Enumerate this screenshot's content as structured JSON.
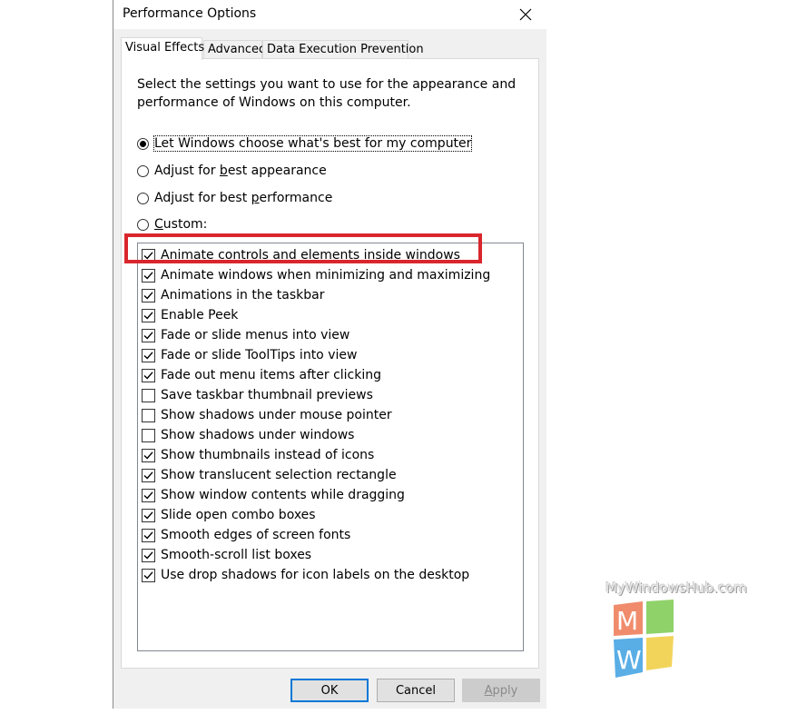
{
  "window": {
    "title": "Performance Options"
  },
  "tabs": [
    {
      "label": "Visual Effects",
      "active": true
    },
    {
      "label": "Advanced",
      "active": false
    },
    {
      "label": "Data Execution Prevention",
      "active": false
    }
  ],
  "description": "Select the settings you want to use for the appearance and performance of Windows on this computer.",
  "radios": [
    {
      "pre": "Let Windows choose what's best for my computer",
      "ul": "",
      "post": "",
      "checked": true
    },
    {
      "pre": "Adjust for ",
      "ul": "b",
      "post": "est appearance",
      "checked": false
    },
    {
      "pre": "Adjust for best ",
      "ul": "p",
      "post": "erformance",
      "checked": false
    },
    {
      "pre": "",
      "ul": "C",
      "post": "ustom:",
      "checked": false
    }
  ],
  "checkboxes": [
    {
      "label": "Animate controls and elements inside windows",
      "checked": true
    },
    {
      "label": "Animate windows when minimizing and maximizing",
      "checked": true
    },
    {
      "label": "Animations in the taskbar",
      "checked": true
    },
    {
      "label": "Enable Peek",
      "checked": true
    },
    {
      "label": "Fade or slide menus into view",
      "checked": true
    },
    {
      "label": "Fade or slide ToolTips into view",
      "checked": true
    },
    {
      "label": "Fade out menu items after clicking",
      "checked": true
    },
    {
      "label": "Save taskbar thumbnail previews",
      "checked": false
    },
    {
      "label": "Show shadows under mouse pointer",
      "checked": false
    },
    {
      "label": "Show shadows under windows",
      "checked": false
    },
    {
      "label": "Show thumbnails instead of icons",
      "checked": true
    },
    {
      "label": "Show translucent selection rectangle",
      "checked": true
    },
    {
      "label": "Show window contents while dragging",
      "checked": true
    },
    {
      "label": "Slide open combo boxes",
      "checked": true
    },
    {
      "label": "Smooth edges of screen fonts",
      "checked": true
    },
    {
      "label": "Smooth-scroll list boxes",
      "checked": true
    },
    {
      "label": "Use drop shadows for icon labels on the desktop",
      "checked": true
    }
  ],
  "buttons": {
    "ok": "OK",
    "cancel": "Cancel",
    "apply_pre": "",
    "apply_ul": "A",
    "apply_post": "pply"
  },
  "watermark": {
    "text": "MyWindowsHub.com",
    "logo_letter_m": "M",
    "logo_letter_w": "W"
  },
  "colors": {
    "highlight": "#d9262c",
    "accent": "#0078d7"
  }
}
